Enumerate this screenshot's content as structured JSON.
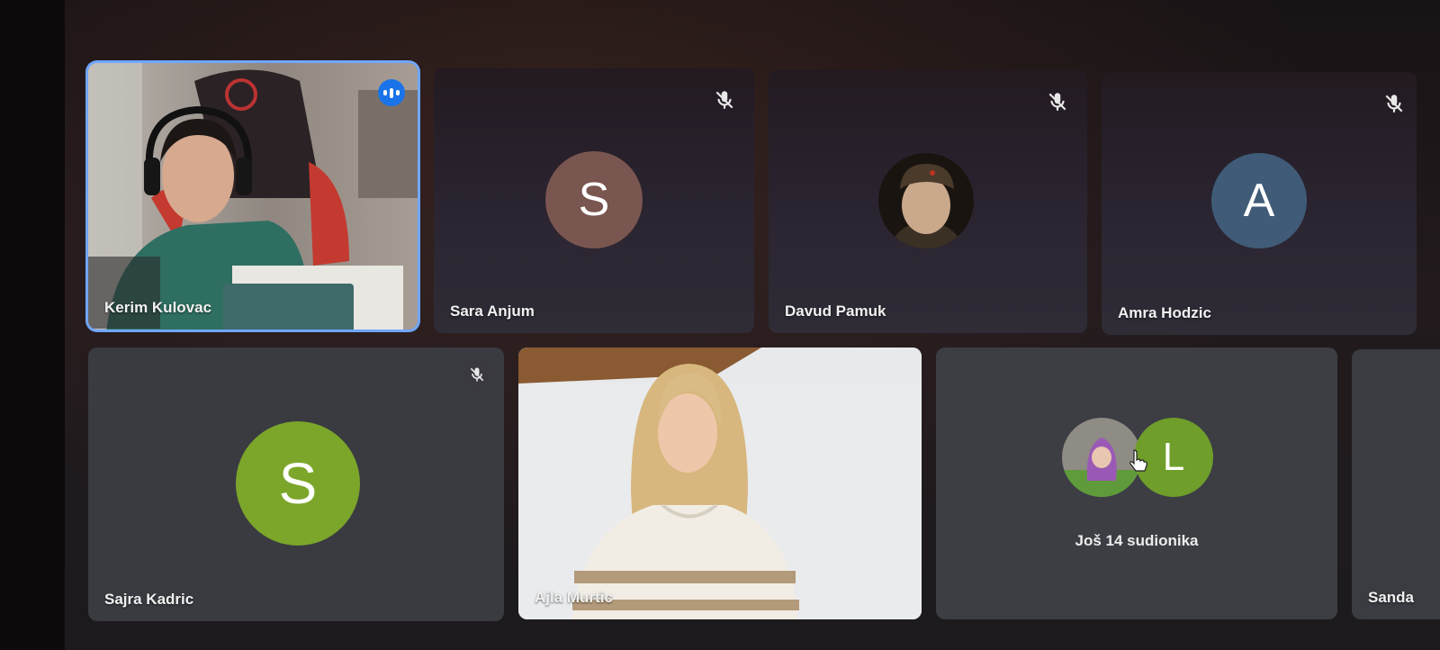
{
  "participants": [
    {
      "name": "Kerim Kulovac",
      "video": true
    },
    {
      "name": "Sara Anjum",
      "initial": "S",
      "muted": true
    },
    {
      "name": "Davud Pamuk",
      "muted": true
    },
    {
      "name": "Amra Hodzic",
      "initial": "A",
      "muted": true
    },
    {
      "name": "Sajra Kadric",
      "initial": "S",
      "muted": true
    },
    {
      "name": "Ajla Murtic",
      "video": true
    },
    {
      "name": "Sanda"
    }
  ],
  "more": {
    "label": "Još 14 sudionika",
    "initial": "L"
  },
  "colors": {
    "active_border": "#6fa6ff",
    "speaking_badge": "#1a73e8",
    "avatar_sara": "#7a5650",
    "avatar_amra": "#3f5b77",
    "avatar_sajra": "#7ca62a",
    "avatar_more": "#6f9e2a"
  }
}
